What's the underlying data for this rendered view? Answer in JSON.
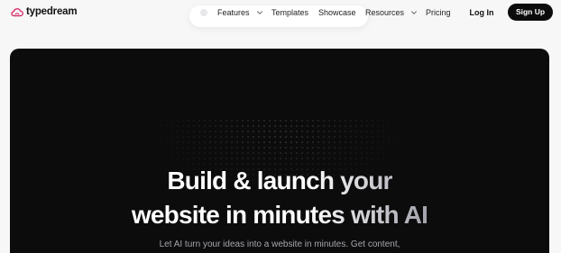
{
  "brand": {
    "name": "typedream",
    "logo_icon": "cloud-logo-icon",
    "accent_color": "#d6336c"
  },
  "nav": {
    "items": [
      {
        "label": "Features",
        "has_dropdown": true
      },
      {
        "label": "Templates",
        "has_dropdown": false
      },
      {
        "label": "Showcase",
        "has_dropdown": false
      },
      {
        "label": "Resources",
        "has_dropdown": true
      },
      {
        "label": "Pricing",
        "has_dropdown": false
      }
    ]
  },
  "auth": {
    "login_label": "Log In",
    "signup_label": "Sign Up"
  },
  "hero": {
    "headline_line1": "Build & launch your",
    "headline_line2": "website in minutes with AI",
    "subtitle": "Let AI turn your ideas into a website in minutes. Get content,"
  },
  "colors": {
    "page_bg": "#f7f7f8",
    "hero_bg": "#0c0c0d",
    "button_dark": "#0b0b0c"
  }
}
